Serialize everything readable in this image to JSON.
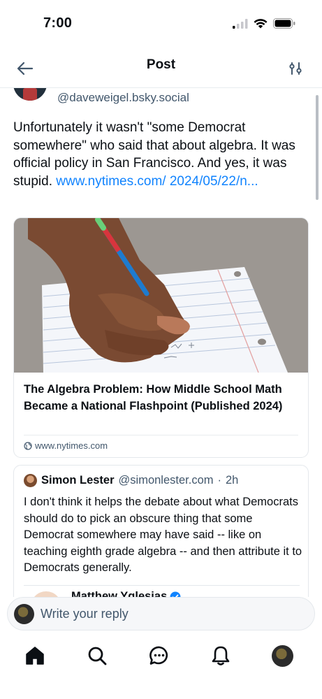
{
  "status": {
    "time": "7:00"
  },
  "header": {
    "title": "Post"
  },
  "post": {
    "author_handle": "@daveweigel.bsky.social",
    "text": "Unfortunately it wasn't \"some Democrat somewhere\" who said that about algebra. It was official policy in San Francisco. And yes, it was stupid. ",
    "link_text": "www.nytimes.com/ 2024/05/22/n..."
  },
  "link_card": {
    "title": "The Algebra Problem: How Middle School Math Became a National Flashpoint (Published 2024)",
    "domain": "www.nytimes.com"
  },
  "quote": {
    "name": "Simon Lester",
    "handle": "@simonlester.com",
    "separator": "·",
    "time": "2h",
    "text": "I don't think it helps the debate about what Democrats should do to pick an obscure thing that some Democrat somewhere may have said -- like on teaching eighth grade algebra -- and then attribute it to Democrats generally.",
    "nested_name": "Matthew Yglesias"
  },
  "reply": {
    "placeholder": "Write your reply"
  },
  "tabs": [
    {
      "icon": "home-icon"
    },
    {
      "icon": "search-icon"
    },
    {
      "icon": "chat-icon"
    },
    {
      "icon": "bell-icon"
    },
    {
      "icon": "profile-avatar"
    }
  ],
  "colors": {
    "link": "#1083fe",
    "muted": "#42576c",
    "verified": "#1083fe"
  }
}
